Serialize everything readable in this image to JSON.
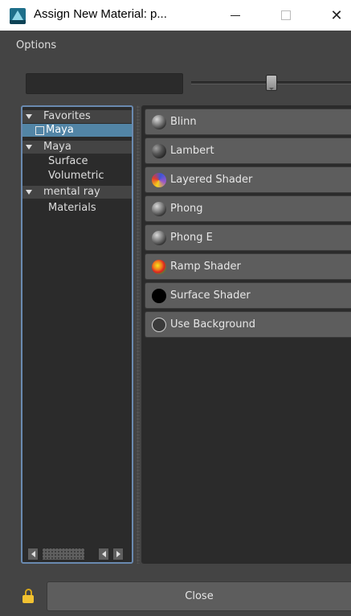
{
  "window": {
    "title": "Assign New Material: p...",
    "minimize_icon": "minimize-icon",
    "maximize_icon": "maximize-icon",
    "close_glyph": "✕"
  },
  "menu": {
    "options_label": "Options"
  },
  "search": {
    "value": "",
    "placeholder": ""
  },
  "size_slider": {
    "level_fraction": 0.5
  },
  "tree": {
    "favorites_label": "Favorites",
    "favorites_maya_label": "Maya",
    "maya_label": "Maya",
    "surface_label": "Surface",
    "volumetric_label": "Volumetric",
    "mental_ray_label": "mental ray",
    "materials_label": "Materials"
  },
  "materials": [
    {
      "label": "Blinn",
      "icon": "blinn-sphere-icon"
    },
    {
      "label": "Lambert",
      "icon": "lambert-sphere-icon"
    },
    {
      "label": "Layered Shader",
      "icon": "layered-shader-sphere-icon"
    },
    {
      "label": "Phong",
      "icon": "phong-sphere-icon"
    },
    {
      "label": "Phong E",
      "icon": "phong-e-sphere-icon"
    },
    {
      "label": "Ramp Shader",
      "icon": "ramp-shader-sphere-icon"
    },
    {
      "label": "Surface Shader",
      "icon": "surface-shader-sphere-icon"
    },
    {
      "label": "Use Background",
      "icon": "use-background-sphere-icon"
    }
  ],
  "footer": {
    "close_label": "Close",
    "lock_icon": "lock-icon"
  },
  "colors": {
    "panel_bg": "#444444",
    "field_bg": "#2b2b2b",
    "button_bg": "#5d5d5d",
    "selection": "#5285a6",
    "tree_border": "#6a8ab0"
  }
}
